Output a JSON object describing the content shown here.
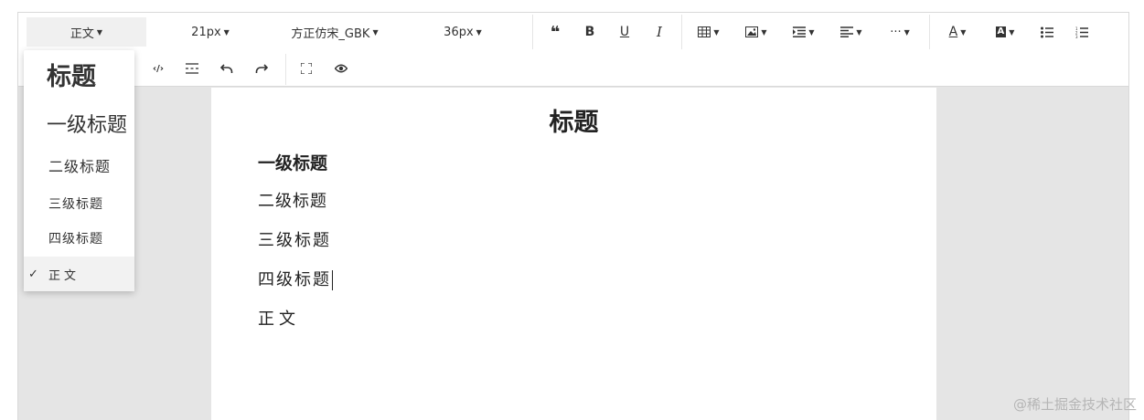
{
  "toolbar": {
    "row1": {
      "heading_select": {
        "value": "正文"
      },
      "font_size_select": {
        "value": "21px"
      },
      "font_family_select": {
        "value": "方正仿宋_GBK"
      },
      "line_height_select": {
        "value": "36px"
      },
      "quote_icon": "❝",
      "bold_label": "B",
      "underline_label": "U",
      "italic_label": "I",
      "more_label": "···",
      "font_color_label": "A",
      "bg_color_label": "A"
    },
    "row2": {
      "code_label": "‹/›"
    }
  },
  "heading_dropdown": {
    "items": [
      {
        "label": "标题"
      },
      {
        "label": "一级标题"
      },
      {
        "label": "二级标题"
      },
      {
        "label": "三级标题"
      },
      {
        "label": "四级标题"
      },
      {
        "label": "正文",
        "selected": true
      }
    ],
    "check_icon": "✓"
  },
  "document": {
    "title": "标题",
    "h1": "一级标题",
    "h2": "二级标题",
    "h3": "三级标题",
    "h4": "四级标题",
    "body": "正文"
  },
  "watermark": "@稀土掘金技术社区"
}
